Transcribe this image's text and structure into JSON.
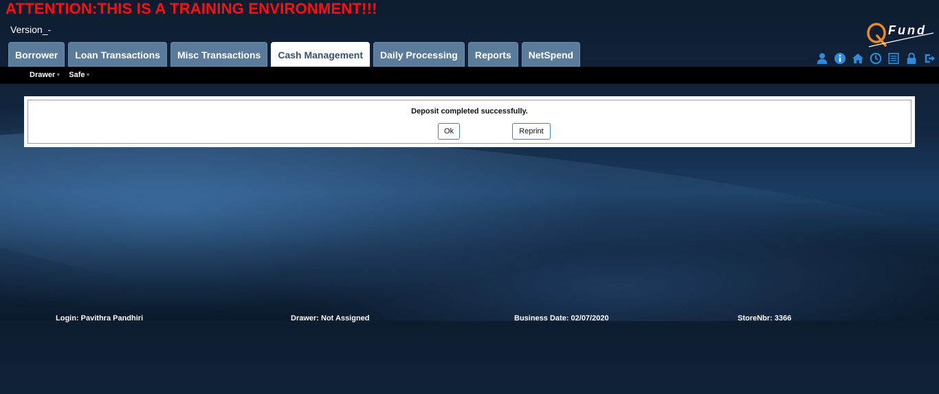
{
  "banner": {
    "text": "ATTENTION:THIS IS A TRAINING ENVIRONMENT!!!"
  },
  "version": {
    "label": "Version_-"
  },
  "logo": {
    "text": "Fund",
    "mark": "Q"
  },
  "tabs": [
    {
      "label": "Borrower"
    },
    {
      "label": "Loan Transactions"
    },
    {
      "label": "Misc Transactions"
    },
    {
      "label": "Cash Management",
      "active": true
    },
    {
      "label": "Daily Processing"
    },
    {
      "label": "Reports"
    },
    {
      "label": "NetSpend"
    }
  ],
  "header_icons": [
    "user-icon",
    "info-icon",
    "home-icon",
    "clock-icon",
    "list-icon",
    "lock-icon",
    "logout-icon"
  ],
  "submenu": {
    "items": [
      {
        "label": "Drawer"
      },
      {
        "label": "Safe"
      }
    ]
  },
  "dialog": {
    "message": "Deposit completed successfully.",
    "ok_label": "Ok",
    "reprint_label": "Reprint"
  },
  "footer": {
    "login": "Login: Pavithra Pandhiri",
    "drawer": "Drawer: Not Assigned",
    "business_date": "Business Date: 02/07/2020",
    "store": "StoreNbr: 3366"
  },
  "colors": {
    "banner": "#ff1010",
    "tab": "#5a7b99",
    "tab_active": "#ffffff",
    "icon": "#2f8ad9",
    "subbar": "#000000"
  }
}
